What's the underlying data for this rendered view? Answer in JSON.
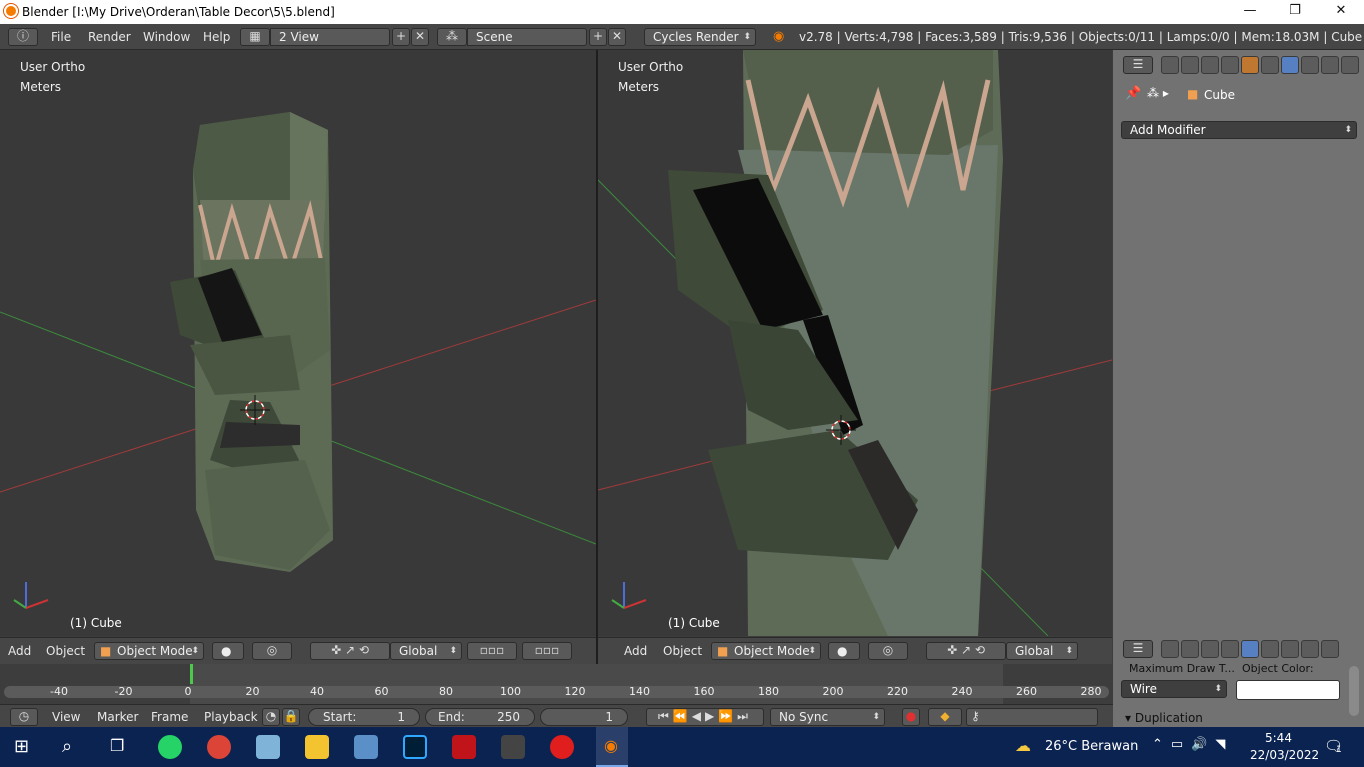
{
  "window": {
    "title": "Blender  [I:\\My Drive\\Orderan\\Table Decor\\5\\5.blend]",
    "minimize": "—",
    "maximize": "❐",
    "close": "✕"
  },
  "info_header": {
    "menus": [
      "File",
      "Render",
      "Window",
      "Help"
    ],
    "screen_layout": "2 View",
    "scene": "Scene",
    "render_engine": "Cycles Render",
    "stats": "v2.78 | Verts:4,798 | Faces:3,589 | Tris:9,536 | Objects:0/11 | Lamps:0/0 | Mem:18.03M | Cube"
  },
  "viewport_left": {
    "view": "User Ortho",
    "units": "Meters",
    "object_label": "(1) Cube"
  },
  "viewport_right": {
    "view": "User Ortho",
    "units": "Meters",
    "object_label": "(1) Cube"
  },
  "viewport_header": {
    "menus": [
      "Add",
      "Object"
    ],
    "mode": "Object Mode",
    "orientation": "Global"
  },
  "properties": {
    "breadcrumb_object": "Cube",
    "add_modifier": "Add Modifier",
    "max_draw_label": "Maximum Draw T...",
    "object_color_label": "Object Color:",
    "draw_type": "Wire",
    "duplication": "Duplication"
  },
  "timeline": {
    "ticks": [
      "-40",
      "-20",
      "0",
      "20",
      "40",
      "60",
      "80",
      "100",
      "120",
      "140",
      "160",
      "180",
      "200",
      "220",
      "240",
      "260",
      "280"
    ],
    "menus": [
      "View",
      "Marker",
      "Frame",
      "Playback"
    ],
    "start_label": "Start:",
    "start": "1",
    "end_label": "End:",
    "end": "250",
    "current": "1",
    "sync": "No Sync"
  },
  "taskbar": {
    "weather": "26°C  Berawan",
    "time": "5:44",
    "date": "22/03/2022",
    "notifications": "1"
  },
  "colors": {
    "accent": "#5680c2",
    "viewport_bg": "#393939",
    "header_bg": "#464646",
    "props_bg": "#727272",
    "taskbar_bg": "#0b2350"
  }
}
